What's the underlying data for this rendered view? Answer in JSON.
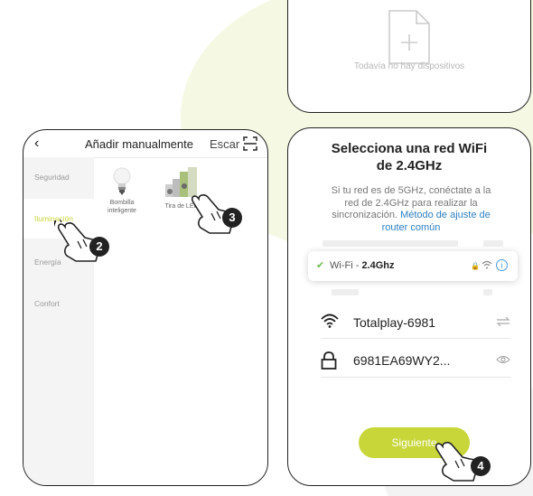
{
  "top_screen": {
    "empty_text": "Todavía no hay dispositivos"
  },
  "left_screen": {
    "header": {
      "title": "Añadir manualmente",
      "right_label": "Escar"
    },
    "sidebar": [
      {
        "label": "Seguridad",
        "active": false
      },
      {
        "label": "Iluminación",
        "active": true
      },
      {
        "label": "Energía",
        "active": false
      },
      {
        "label": "Confort",
        "active": false
      }
    ],
    "devices": [
      {
        "label_line1": "Bombilla",
        "label_line2": "inteligente",
        "icon": "bulb-icon"
      },
      {
        "label_line1": "Tira de LED",
        "label_line2": "",
        "icon": "led-strip-icon"
      }
    ]
  },
  "right_screen": {
    "title_line1": "Selecciona una red WiFi",
    "title_line2": "de 2.4GHz",
    "desc_line1": "Si tu red es de 5GHz, conéctate a la",
    "desc_line2": "red de 2.4GHz para realizar la",
    "desc_line3_plain": "sincronización. ",
    "desc_link_part1": "Método de ajuste de",
    "desc_link_part2": "router común",
    "wifi_card": {
      "prefix": "Wi-Fi - ",
      "band": "2.4Ghz"
    },
    "network_name": "Totalplay-6981",
    "password": "6981EA69WY2...",
    "next_button": "Siguiente"
  },
  "steps": {
    "step2": "2",
    "step3": "3",
    "step4": "4"
  },
  "colors": {
    "accent": "#c8d63a",
    "link": "#2f7fc1",
    "check": "#6bbf4e",
    "bg_shape": "#f1f6d6"
  }
}
